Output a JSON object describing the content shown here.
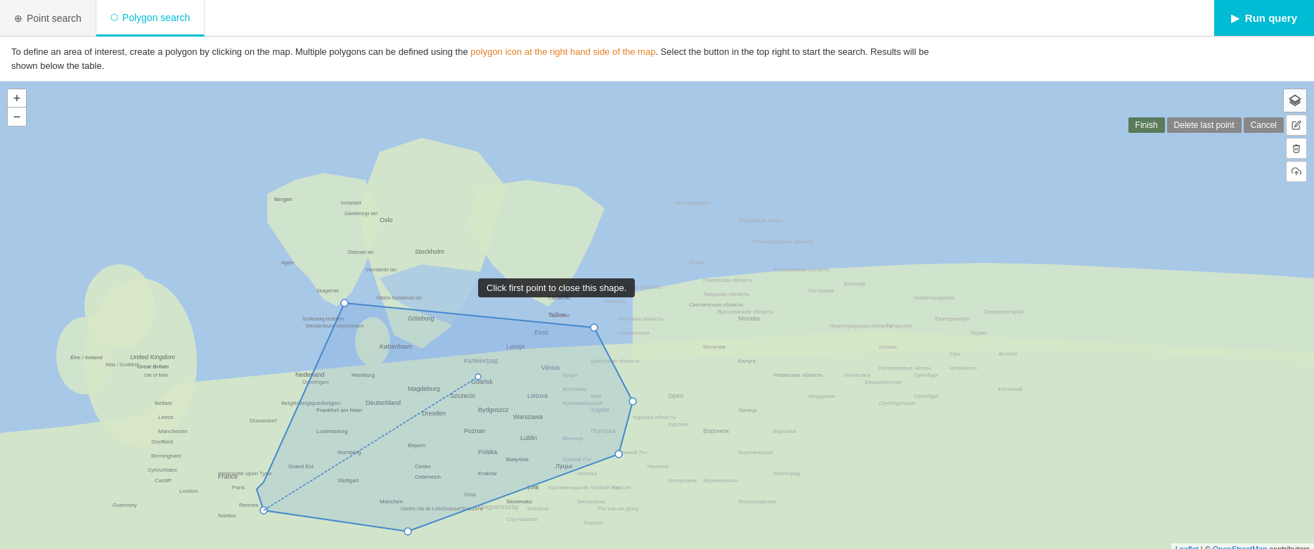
{
  "tabs": [
    {
      "id": "point-search",
      "label": "Point search",
      "icon": "⊕",
      "active": false
    },
    {
      "id": "polygon-search",
      "label": "Polygon search",
      "icon": "⬡",
      "active": true
    }
  ],
  "header": {
    "run_query_label": "Run query",
    "run_query_icon": "▶"
  },
  "info_bar": {
    "text_normal_1": "To define an area of interest, create a polygon by clicking on the map. Multiple polygons can be defined using the polygon icon at the right hand side of the map. Select the button in the top right to start the search. Results will be",
    "text_normal_2": "shown below the table.",
    "highlighted_phrase": "polygon icon at the right hand side of the map"
  },
  "map": {
    "zoom_in": "+",
    "zoom_out": "−",
    "tooltip": "Click first point to close this shape.",
    "attribution_text": "Leaflet | © OpenStreetMap contributors"
  },
  "draw_toolbar": {
    "finish_label": "Finish",
    "delete_last_label": "Delete last point",
    "cancel_label": "Cancel"
  },
  "colors": {
    "accent": "#00bcd4",
    "polygon_fill": "rgba(100,150,220,0.2)",
    "polygon_stroke": "#4488cc",
    "land": "#e8ecd8",
    "water": "#a8c8e8",
    "tab_active_border": "#00bcd4"
  }
}
